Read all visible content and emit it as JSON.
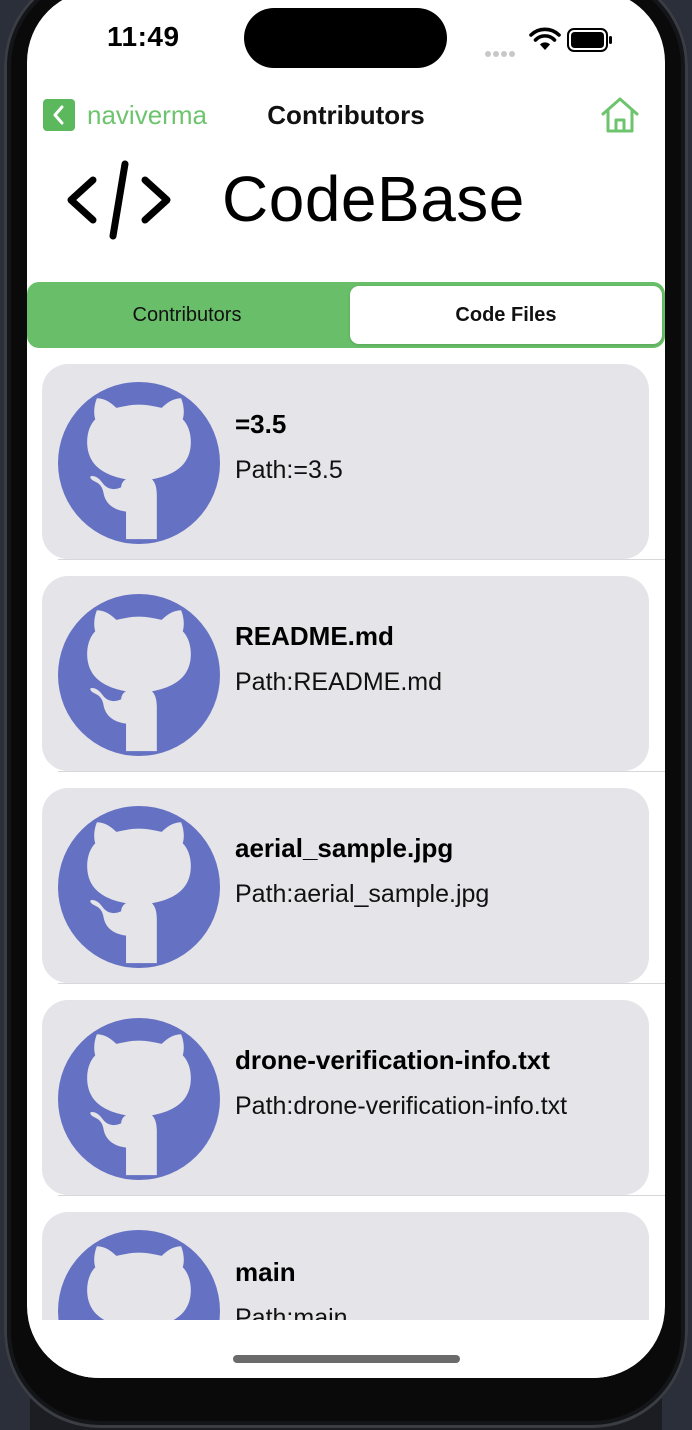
{
  "status_bar": {
    "time": "11:49"
  },
  "nav": {
    "back_label": "naviverma",
    "title": "Contributors"
  },
  "brand": {
    "title": "CodeBase"
  },
  "segmented": {
    "tabs": [
      "Contributors",
      "Code Files"
    ],
    "selected": "Code Files"
  },
  "files": [
    {
      "name": "=3.5",
      "path": "Path:=3.5"
    },
    {
      "name": "README.md",
      "path": "Path:README.md"
    },
    {
      "name": "aerial_sample.jpg",
      "path": "Path:aerial_sample.jpg"
    },
    {
      "name": "drone-verification-info.txt",
      "path": "Path:drone-verification-info.txt"
    },
    {
      "name": "main",
      "path": "Path:main"
    }
  ],
  "colors": {
    "accent": "#5cb85c",
    "segment_bg": "#69bf69",
    "avatar": "#6571c2",
    "card": "#e4e4e9"
  },
  "icons": {
    "back": "chevron-left-icon",
    "home": "house-icon",
    "logo": "code-brackets-icon",
    "avatar": "github-octocat-icon"
  }
}
